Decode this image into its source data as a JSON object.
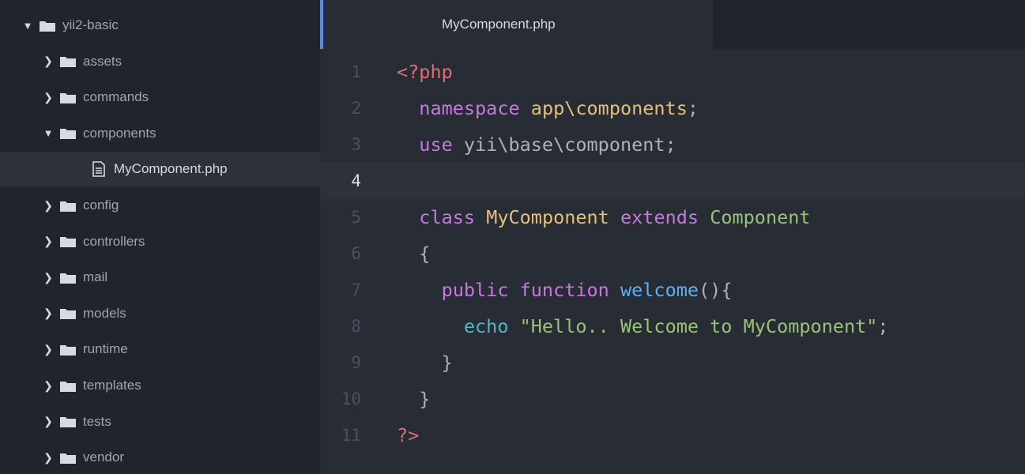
{
  "colors": {
    "sidebar_bg": "#21252b",
    "editor_bg": "#282c34",
    "accent": "#568af2",
    "keyword": "#c678dd",
    "string": "#98c379",
    "class": "#e5c07b",
    "function": "#61afef",
    "php_tag": "#e06c75"
  },
  "tree": {
    "root": {
      "label": "yii2-basic",
      "icon": "folder-icon",
      "expanded": true
    },
    "items": [
      {
        "label": "assets",
        "type": "folder",
        "expanded": false
      },
      {
        "label": "commands",
        "type": "folder",
        "expanded": false
      },
      {
        "label": "components",
        "type": "folder",
        "expanded": true
      },
      {
        "label": "MyComponent.php",
        "type": "file",
        "selected": true
      },
      {
        "label": "config",
        "type": "folder",
        "expanded": false
      },
      {
        "label": "controllers",
        "type": "folder",
        "expanded": false
      },
      {
        "label": "mail",
        "type": "folder",
        "expanded": false
      },
      {
        "label": "models",
        "type": "folder",
        "expanded": false
      },
      {
        "label": "runtime",
        "type": "folder",
        "expanded": false
      },
      {
        "label": "templates",
        "type": "folder",
        "expanded": false
      },
      {
        "label": "tests",
        "type": "folder",
        "expanded": false
      },
      {
        "label": "vendor",
        "type": "folder",
        "expanded": false
      }
    ]
  },
  "editor": {
    "active_tab": "MyComponent.php",
    "current_line": 4,
    "lines": [
      {
        "num": "1",
        "tokens": [
          [
            "tag",
            "<?php"
          ]
        ]
      },
      {
        "num": "2",
        "tokens": [
          [
            "plain",
            "  "
          ],
          [
            "kw",
            "namespace"
          ],
          [
            "plain",
            " "
          ],
          [
            "ns",
            "app\\components"
          ],
          [
            "plain",
            ";"
          ]
        ]
      },
      {
        "num": "3",
        "tokens": [
          [
            "plain",
            "  "
          ],
          [
            "kw",
            "use"
          ],
          [
            "plain",
            " yii\\base\\component;"
          ]
        ]
      },
      {
        "num": "4",
        "tokens": []
      },
      {
        "num": "5",
        "tokens": [
          [
            "plain",
            "  "
          ],
          [
            "kw",
            "class"
          ],
          [
            "plain",
            " "
          ],
          [
            "cls",
            "MyComponent"
          ],
          [
            "plain",
            " "
          ],
          [
            "kw",
            "extends"
          ],
          [
            "plain",
            " "
          ],
          [
            "sup",
            "Component"
          ]
        ]
      },
      {
        "num": "6",
        "tokens": [
          [
            "plain",
            "  {"
          ]
        ]
      },
      {
        "num": "7",
        "tokens": [
          [
            "plain",
            "    "
          ],
          [
            "kw",
            "public"
          ],
          [
            "plain",
            " "
          ],
          [
            "kw",
            "function"
          ],
          [
            "plain",
            " "
          ],
          [
            "fn",
            "welcome"
          ],
          [
            "plain",
            "(){"
          ]
        ]
      },
      {
        "num": "8",
        "tokens": [
          [
            "plain",
            "      "
          ],
          [
            "echo",
            "echo"
          ],
          [
            "plain",
            " "
          ],
          [
            "str",
            "\"Hello.. Welcome to MyComponent\""
          ],
          [
            "plain",
            ";"
          ]
        ]
      },
      {
        "num": "9",
        "tokens": [
          [
            "plain",
            "    }"
          ]
        ]
      },
      {
        "num": "10",
        "tokens": [
          [
            "plain",
            "  }"
          ]
        ]
      },
      {
        "num": "11",
        "tokens": [
          [
            "tag",
            "?>"
          ]
        ]
      }
    ]
  }
}
